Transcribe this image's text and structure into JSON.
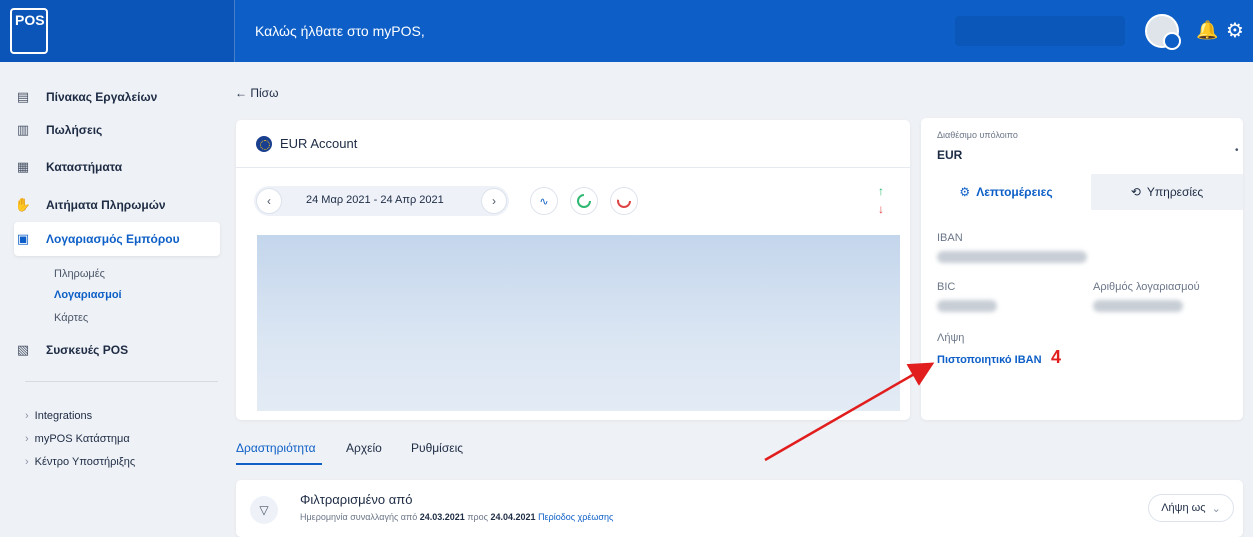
{
  "header": {
    "logo_text": "POS",
    "welcome": "Καλώς ήλθατε στο myPOS,"
  },
  "sidebar": {
    "items": [
      {
        "label": "Πίνακας Εργαλείων"
      },
      {
        "label": "Πωλήσεις"
      },
      {
        "label": "Καταστήματα"
      },
      {
        "label": "Αιτήματα Πληρωμών"
      },
      {
        "label": "Λογαριασμός Εμπόρου"
      },
      {
        "label": "Συσκευές POS"
      }
    ],
    "sub_items": [
      {
        "label": "Πληρωμές"
      },
      {
        "label": "Λογαριασμοί"
      },
      {
        "label": "Κάρτες"
      }
    ],
    "extras": [
      {
        "label": "Integrations"
      },
      {
        "label": "myPOS Κατάστημα"
      },
      {
        "label": "Κέντρο Υποστήριξης"
      }
    ]
  },
  "main": {
    "back_label": "← Πίσω",
    "account_title": "EUR Account",
    "date_range": "24 Μαρ 2021 - 24 Απρ 2021"
  },
  "balance": {
    "label": "Διαθέσιμο υπόλοιπο",
    "currency": "EUR"
  },
  "details": {
    "tab_details": "Λεπτομέρειες",
    "tab_services": "Υπηρεσίες",
    "iban_label": "IBAN",
    "bic_label": "BIC",
    "account_number_label": "Αριθμός λογαριασμού",
    "download_label": "Λήψη",
    "certificate_link": "Πιστοποιητικό IBAN",
    "annotation_number": "4"
  },
  "tabs": {
    "activity": "Δραστηριότητα",
    "archive": "Αρχείο",
    "settings": "Ρυθμίσεις"
  },
  "filter": {
    "title": "Φιλτραρισμένο από",
    "sub_prefix": "Ημερομηνία συναλλαγής από",
    "date_from": "24.03.2021",
    "sub_to": "προς",
    "date_to": "24.04.2021",
    "period": "Περίοδος χρέωσης",
    "download_as": "Λήψη ως"
  },
  "colors": {
    "brand_blue": "#0d5fc7",
    "annotation_red": "#e11d1d"
  }
}
